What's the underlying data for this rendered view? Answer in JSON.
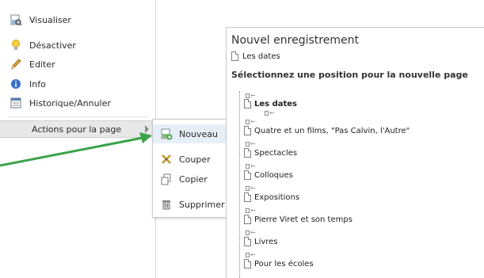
{
  "context_menu": {
    "items": [
      {
        "label": "Visualiser",
        "icon": "page-magnifier-icon"
      },
      {
        "label": "Désactiver",
        "icon": "lightbulb-icon"
      },
      {
        "label": "Editer",
        "icon": "pencil-icon"
      },
      {
        "label": "Info",
        "icon": "info-icon"
      },
      {
        "label": "Historique/Annuler",
        "icon": "history-icon"
      }
    ],
    "actions_label": "Actions pour la page"
  },
  "submenu": {
    "items": [
      {
        "label": "Nouveau",
        "icon": "new-page-icon"
      },
      {
        "label": "Couper",
        "icon": "scissors-icon"
      },
      {
        "label": "Copier",
        "icon": "copy-icon"
      },
      {
        "label": "Supprimer",
        "icon": "trash-icon"
      }
    ]
  },
  "panel": {
    "title": "Nouvel enregistrement",
    "current_page": "Les dates",
    "prompt": "Sélectionnez une position pour la nouvelle page",
    "tree": [
      {
        "label": "Les dates",
        "bold": true
      },
      {
        "label": "Quatre et un films, \"Pas Calvin, l'Autre\"",
        "bold": false
      },
      {
        "label": "Spectacles",
        "bold": false
      },
      {
        "label": "Colloques",
        "bold": false
      },
      {
        "label": "Expositions",
        "bold": false
      },
      {
        "label": "Pierre Viret et son temps",
        "bold": false
      },
      {
        "label": "Livres",
        "bold": false
      },
      {
        "label": "Pour les écoles",
        "bold": false
      }
    ]
  },
  "colors": {
    "annotation_arrow": "#3aa34a",
    "submenu_hover": "#e6eef8"
  }
}
